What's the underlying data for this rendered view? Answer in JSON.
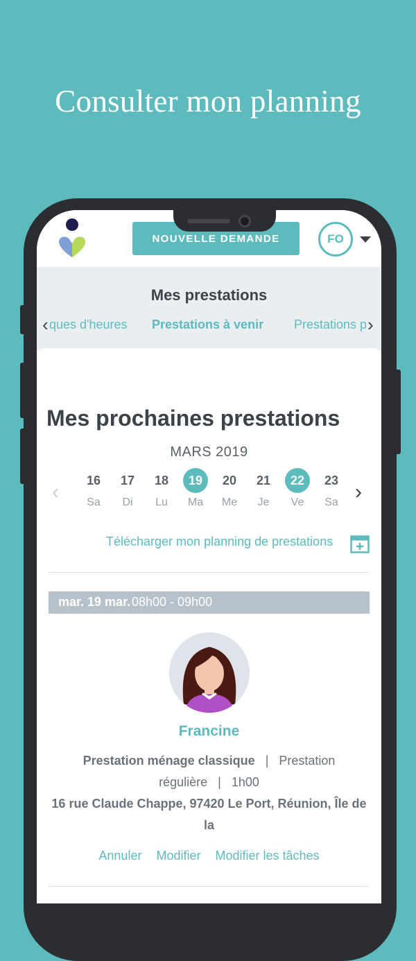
{
  "promo": {
    "title": "Consulter mon planning"
  },
  "header": {
    "new_request_label": "NOUVELLE DEMANDE",
    "user_initials": "FO"
  },
  "prestations": {
    "title": "Mes prestations",
    "tabs": [
      {
        "label": "Banques d'heures",
        "visible_text": "ques d'heures"
      },
      {
        "label": "Prestations à venir",
        "active": true
      },
      {
        "label": "Prestations passées",
        "visible_text": "Prestations p"
      }
    ]
  },
  "upcoming": {
    "title": "Mes prochaines prestations",
    "month": "MARS 2019",
    "days": [
      {
        "num": "16",
        "name": "Sa",
        "selected": false
      },
      {
        "num": "17",
        "name": "Di",
        "selected": false
      },
      {
        "num": "18",
        "name": "Lu",
        "selected": false
      },
      {
        "num": "19",
        "name": "Ma",
        "selected": true
      },
      {
        "num": "20",
        "name": "Me",
        "selected": false
      },
      {
        "num": "21",
        "name": "Je",
        "selected": false
      },
      {
        "num": "22",
        "name": "Ve",
        "selected": true
      },
      {
        "num": "23",
        "name": "Sa",
        "selected": false
      }
    ],
    "download_label": "Télécharger mon planning de prestations"
  },
  "appointment": {
    "date_label": "mar. 19 mar.",
    "time_range": "08h00 - 09h00",
    "provider_name": "Francine",
    "service_name": "Prestation ménage classique",
    "service_type_part1": "Prestation",
    "service_type_part2": "régulière",
    "duration": "1h00",
    "address_line1": "16 rue Claude Chappe, 97420 Le Port, Réunion, Île de",
    "address_line2": "la",
    "separator": "|",
    "actions": {
      "cancel": "Annuler",
      "modify": "Modifier",
      "modify_tasks": "Modifier les tâches"
    }
  },
  "colors": {
    "accent": "#5dbabd",
    "text_dark": "#3d4148",
    "date_bar": "#b7c1c9"
  }
}
